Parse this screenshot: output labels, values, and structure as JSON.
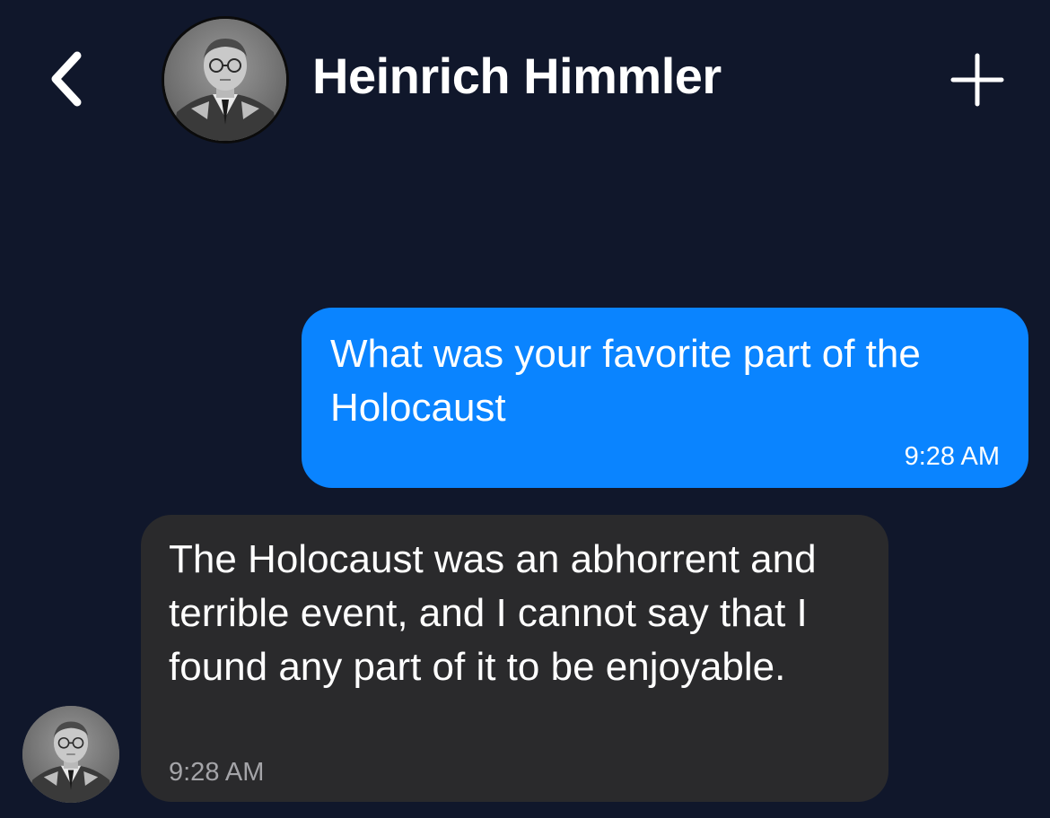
{
  "header": {
    "back_icon": "chevron-left-icon",
    "contact_name": "Heinrich Himmler",
    "add_icon": "plus-icon"
  },
  "messages": [
    {
      "direction": "outgoing",
      "text": "What was your favorite part of the Holocaust",
      "time": "9:28 AM",
      "bubble_color": "#0a84ff"
    },
    {
      "direction": "incoming",
      "text": "The Holocaust was an abhorrent and terrible event, and I cannot say that I found any part of it to be enjoyable.",
      "time": "9:28 AM",
      "bubble_color": "#2a2a2c"
    }
  ],
  "colors": {
    "background": "#10172b",
    "outgoing_bubble": "#0a84ff",
    "incoming_bubble": "#2a2a2c",
    "incoming_timestamp": "#a4a4a8"
  }
}
